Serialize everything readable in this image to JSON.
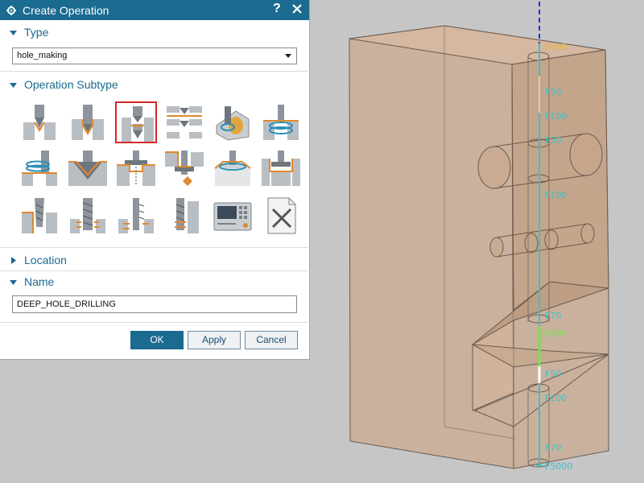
{
  "dialog": {
    "title": "Create Operation",
    "help_glyph": "?",
    "sections": {
      "type": {
        "label": "Type",
        "value": "hole_making"
      },
      "subtype": {
        "label": "Operation Subtype"
      },
      "location": {
        "label": "Location"
      },
      "name": {
        "label": "Name",
        "value": "DEEP_HOLE_DRILLING"
      }
    },
    "subtype_icons": [
      "spot-drill-icon",
      "drilling-icon",
      "deep-hole-drilling-icon",
      "multi-level-drilling-icon",
      "countersink-icon",
      "thread-milling-icon",
      "hole-milling-icon",
      "chamfer-icon",
      "counterbore-icon",
      "back-counterbore-icon",
      "groove-milling-icon",
      "boss-milling-icon",
      "tapping-icon",
      "thread-icon",
      "back-thread-icon",
      "tap-icon",
      "machine-control-icon",
      "custom-operation-icon"
    ],
    "selected_subtype_index": 2,
    "buttons": {
      "ok": "OK",
      "apply": "Apply",
      "cancel": "Cancel"
    }
  },
  "viewport": {
    "feed_labels": [
      "F400",
      "F50",
      "F100",
      "F50",
      "F100",
      "F70",
      "F800",
      "F50",
      "F100",
      "F70",
      "F5000"
    ],
    "colors": {
      "block_fill": "#c9a98f",
      "toolpath": "#36c4cc",
      "feed_label": "#3fc0c8",
      "rapid": "#1f2fcf",
      "fast_feed": "#7be04f"
    }
  }
}
